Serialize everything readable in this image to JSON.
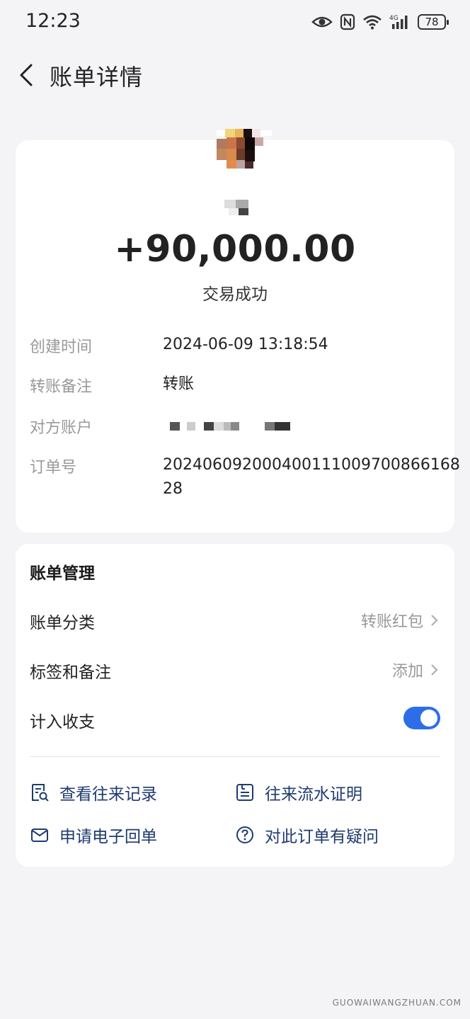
{
  "status_bar": {
    "time": "12:23",
    "battery": "78",
    "network": "4G"
  },
  "nav": {
    "title": "账单详情"
  },
  "transaction": {
    "amount": "+90,000.00",
    "status": "交易成功",
    "details": [
      {
        "label": "创建时间",
        "value": "2024-06-09 13:18:54"
      },
      {
        "label": "转账备注",
        "value": "转账"
      },
      {
        "label": "对方账户",
        "value": ""
      },
      {
        "label": "订单号",
        "value": "20240609200040011100970086616828"
      }
    ]
  },
  "management": {
    "title": "账单管理",
    "category": {
      "label": "账单分类",
      "value": "转账红包"
    },
    "tags": {
      "label": "标签和备注",
      "value": "添加"
    },
    "count_in_budget": {
      "label": "计入收支",
      "enabled": true
    }
  },
  "actions": [
    {
      "label": "查看往来记录",
      "icon": "record-search-icon"
    },
    {
      "label": "往来流水证明",
      "icon": "statement-doc-icon"
    },
    {
      "label": "申请电子回单",
      "icon": "envelope-icon"
    },
    {
      "label": "对此订单有疑问",
      "icon": "question-circle-icon"
    }
  ],
  "watermark": "GUOWAIWANGZHUAN.COM",
  "colors": {
    "accent": "#2d6ee8",
    "action_text": "#1f3b6f"
  }
}
